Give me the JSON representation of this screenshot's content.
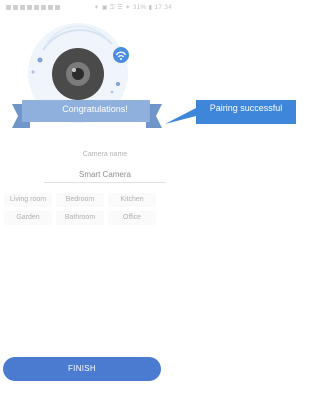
{
  "status_bar": {
    "right_text": "✶ ▣ ⚿ ☰ ✶ 31% ▮ 17:34"
  },
  "banner": {
    "text": "Congratulations!"
  },
  "callout": {
    "text": "Pairing successful"
  },
  "camera_name": {
    "label": "Camera name",
    "value": "Smart Camera"
  },
  "rooms": [
    "Living room",
    "Bedroom",
    "Kitchen",
    "Garden",
    "Bathroom",
    "Office"
  ],
  "finish_button": {
    "label": "FINISH"
  },
  "colors": {
    "accent": "#4b7bd1",
    "banner": "#8fb0dc",
    "callout": "#3e86d9"
  },
  "icons": [
    "wifi-icon",
    "camera-icon",
    "check-badge-icon"
  ]
}
